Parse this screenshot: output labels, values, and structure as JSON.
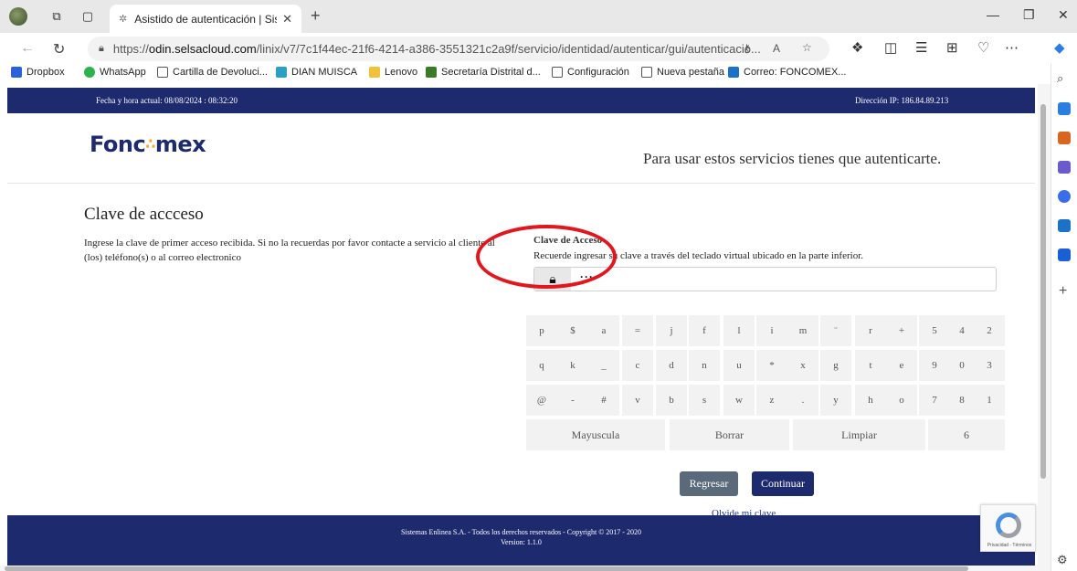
{
  "browser": {
    "tab_title": "Asistido de autenticación | Sisten",
    "url_prefix": "https://",
    "url_host": "odin.selsacloud.com",
    "url_path": "/linix/v7/7c1f44ec-21f6-4214-a386-3551321c2a9f/servicio/identidad/autenticar/gui/autenticacio...",
    "bookmarks": [
      "Dropbox",
      "WhatsApp",
      "Cartilla de Devoluci...",
      "DIAN MUISCA",
      "Lenovo",
      "Secretaría Distrital d...",
      "Configuración",
      "Nueva pestaña",
      "Correo: FONCOMEX..."
    ]
  },
  "page": {
    "datetime": "Fecha y hora actual: 08/08/2024 : 08:32:20",
    "ip": "Dirección IP: 186.84.89.213",
    "logo_left": "Fonc",
    "logo_dots": "∴",
    "logo_right": "mex",
    "tagline": "Para usar estos servicios tienes que autenticarte.",
    "heading": "Clave de accceso",
    "instructions": "Ingrese la clave de primer acceso recibida. Si no la recuerdas por favor contacte a servicio al cliente al (los) teléfono(s) o al correo electronico",
    "password_label": "Clave de Acceso",
    "password_hint": "Recuerde ingresar su clave a través del teclado virtual ubicado en la parte inferior.",
    "password_value": "····",
    "keys": [
      [
        "p",
        "$",
        "a",
        "=",
        "j",
        "f",
        "l",
        "i",
        "m",
        "¨",
        "r",
        "+",
        "5",
        "4",
        "2"
      ],
      [
        "q",
        "k",
        "_",
        "c",
        "d",
        "n",
        "u",
        "*",
        "x",
        "g",
        "t",
        "e",
        "9",
        "0",
        "3"
      ],
      [
        "@",
        "-",
        "#",
        "v",
        "b",
        "s",
        "w",
        "z",
        ".",
        "y",
        "h",
        "o",
        "7",
        "8",
        "1"
      ]
    ],
    "key_mayuscula": "Mayuscula",
    "key_borrar": "Borrar",
    "key_limpiar": "Limpiar",
    "key_six": "6",
    "btn_back": "Regresar",
    "btn_next": "Continuar",
    "forgot": "Olvide mi clave",
    "footer_l1": "Sistemas Enlinea S.A. - Todos los derechos reservados - Copyright © 2017 - 2020",
    "footer_l2": "Version: 1.1.0",
    "recaptcha_text": "Privacidad - Términos"
  },
  "colors": {
    "brand_navy": "#1e2a6e",
    "logo_accent": "#f5a623",
    "annotation_red": "#e3161e"
  }
}
